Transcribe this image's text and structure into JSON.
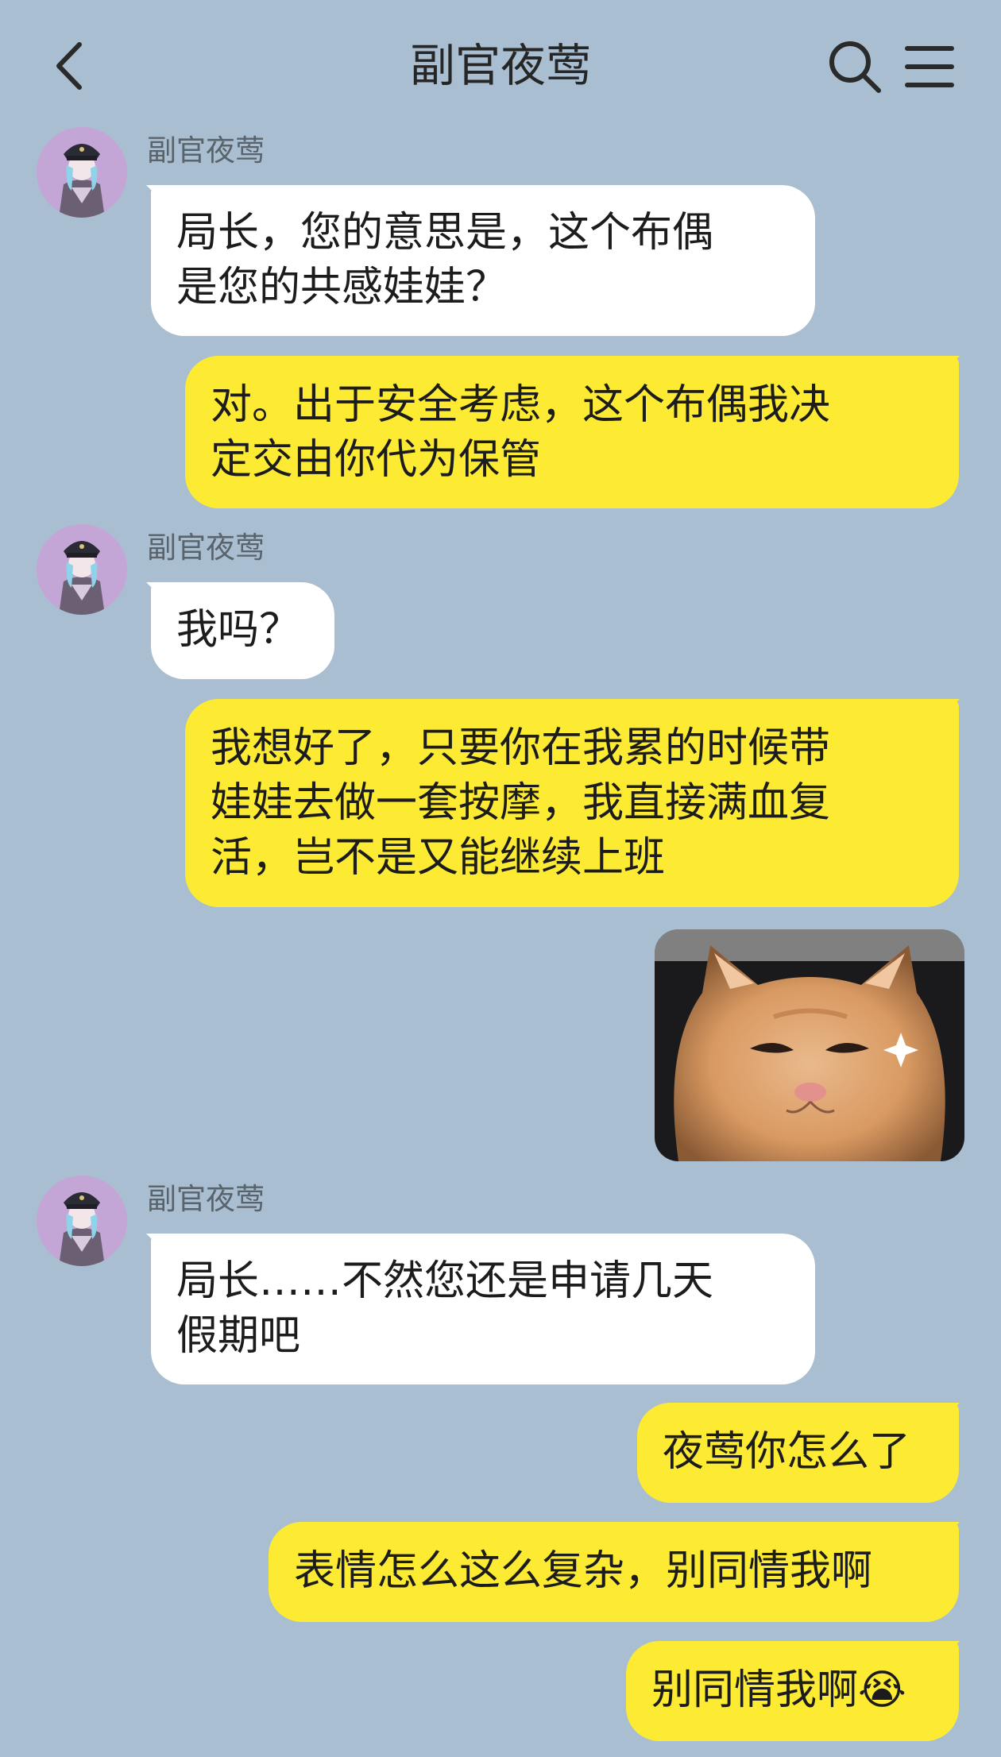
{
  "header": {
    "title": "副官夜莺",
    "back_icon": "chevron-left-icon",
    "search_icon": "search-icon",
    "menu_icon": "menu-icon"
  },
  "messages": [
    {
      "side": "in",
      "sender": "副官夜莺",
      "lines": [
        "局长，您的意思是，这个布偶",
        "是您的共感娃娃？"
      ]
    },
    {
      "side": "out",
      "lines": [
        "对。出于安全考虑，这个布偶我决",
        "定交由你代为保管"
      ]
    },
    {
      "side": "in",
      "sender": "副官夜莺",
      "lines": [
        "我吗？"
      ]
    },
    {
      "side": "out",
      "lines": [
        "我想好了，只要你在我累的时候带",
        "娃娃去做一套按摩，我直接满血复",
        "活，岂不是又能继续上班"
      ]
    },
    {
      "side": "out",
      "type": "sticker",
      "sticker": "kitten-sticker"
    },
    {
      "side": "in",
      "sender": "副官夜莺",
      "lines": [
        "局长……不然您还是申请几天",
        "假期吧"
      ]
    },
    {
      "side": "out",
      "lines": [
        "夜莺你怎么了"
      ]
    },
    {
      "side": "out",
      "lines": [
        "表情怎么这么复杂，别同情我啊"
      ]
    },
    {
      "side": "out",
      "lines": [
        "别同情我啊😭"
      ]
    }
  ],
  "colors": {
    "background": "#a9bfd1",
    "incoming_bubble": "#ffffff",
    "outgoing_bubble": "#fdeb33"
  }
}
